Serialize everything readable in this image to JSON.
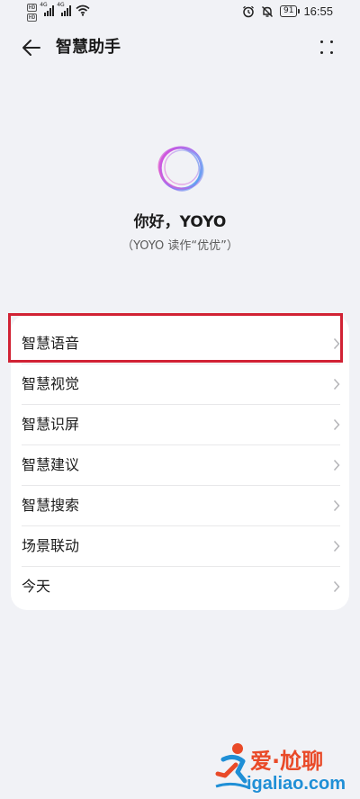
{
  "status_bar": {
    "hd_badges": [
      "HD",
      "HD"
    ],
    "signal_labels": [
      "4G",
      "4G"
    ],
    "battery": "91",
    "time": "16:55",
    "icons": [
      "alarm-icon",
      "mute-icon",
      "battery-icon",
      "wifi-icon",
      "signal-icon"
    ]
  },
  "header": {
    "title": "智慧助手",
    "back_icon": "arrow-left-icon",
    "more_icon": "more-dots-icon"
  },
  "hero": {
    "greeting": "你好，YOYO",
    "pronunciation": "（YOYO 读作“优优”）"
  },
  "menu": {
    "items": [
      {
        "label": "智慧语音"
      },
      {
        "label": "智慧视觉"
      },
      {
        "label": "智慧识屏"
      },
      {
        "label": "智慧建议"
      },
      {
        "label": "智慧搜索"
      },
      {
        "label": "场景联动"
      },
      {
        "label": "今天"
      }
    ],
    "highlighted_item": "智慧语音",
    "highlight_color": "#d12234"
  },
  "watermark": {
    "brand": "爱·尬聊",
    "url": "igaliao.com"
  },
  "colors": {
    "background": "#f1f2f6",
    "card": "#ffffff",
    "text": "#1b1b1b"
  }
}
